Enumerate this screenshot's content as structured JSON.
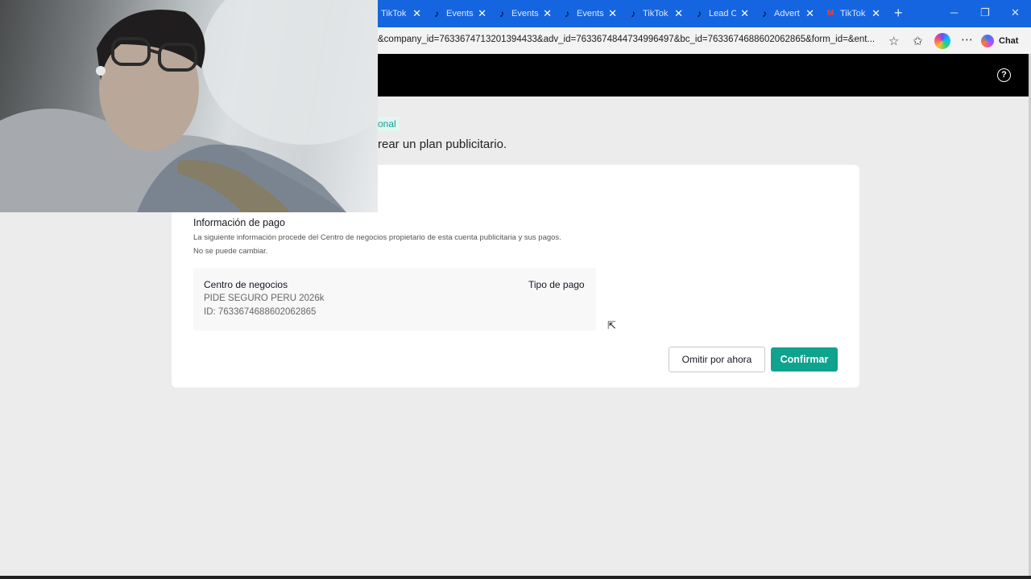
{
  "browser": {
    "tabs": [
      {
        "label": "TikTok",
        "icon": "tiktok-icon"
      },
      {
        "label": "Events",
        "icon": "tiktok-icon"
      },
      {
        "label": "Events",
        "icon": "tiktok-icon"
      },
      {
        "label": "Events",
        "icon": "tiktok-icon"
      },
      {
        "label": "TikTok",
        "icon": "tiktok-icon"
      },
      {
        "label": "Lead Ce",
        "icon": "tiktok-icon"
      },
      {
        "label": "Advert",
        "icon": "tiktok-icon"
      },
      {
        "label": "TikTok",
        "icon": "gmail-icon"
      }
    ],
    "url": "&company_id=7633674713201394433&adv_id=7633674844734996497&bc_id=7633674688602062865&form_id=&ent...",
    "chat_label": "Chat"
  },
  "page": {
    "tag": "onal",
    "subtitle": "rear un plan publicitario.",
    "payment": {
      "title": "Información de pago",
      "desc_line1": "La siguiente información procede del Centro de negocios propietario de esta cuenta publicitaria y sus pagos.",
      "desc_line2": "No se puede cambiar.",
      "bc_label": "Centro de negocios",
      "bc_name": "PIDE SEGURO PERU 2026k",
      "bc_id": "ID: 7633674688602062865",
      "payment_type_label": "Tipo de pago"
    },
    "buttons": {
      "skip": "Omitir por ahora",
      "confirm": "Confirmar"
    }
  },
  "colors": {
    "accent": "#0fa38e",
    "tabbar": "#1565e0"
  }
}
